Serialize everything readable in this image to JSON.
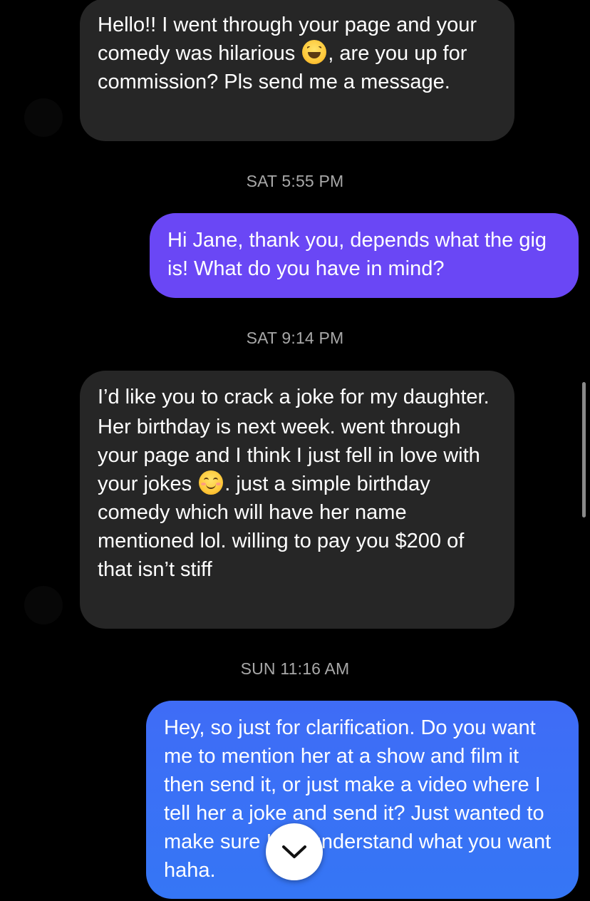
{
  "messages": [
    {
      "direction": "incoming",
      "text_a": "Hello!! I went through your page and your comedy was hilarious ",
      "emoji": "grinning-squinting-face",
      "text_b": ", are you up for commission? Pls send me a message."
    },
    {
      "direction": "timestamp",
      "text": "SAT 5:55 PM"
    },
    {
      "direction": "outgoing",
      "text": "Hi Jane, thank you, depends what the gig is! What do you have in mind?"
    },
    {
      "direction": "timestamp",
      "text": "SAT 9:14 PM"
    },
    {
      "direction": "incoming",
      "line1": "I’d like you to crack a joke for my daughter.",
      "text_a": "Her birthday is next week. went through your page and I think I just fell in love with your jokes ",
      "emoji": "smiling-face-with-smiling-eyes",
      "text_b": ". just a simple birthday comedy which will have her name mentioned lol. willing to pay you $200 of that isn’t stiff"
    },
    {
      "direction": "timestamp",
      "text": "SUN 11:16 AM"
    },
    {
      "direction": "outgoing",
      "text": "Hey, so just for clarification. Do you want me to mention her at a show and film it then send it, or just make a video where I tell her a joke and send it? Just wanted to make sure I full understand what you want haha."
    }
  ],
  "colors": {
    "background": "#000000",
    "incoming_bubble": "#262626",
    "outgoing_bubble_purple": "#6a47f5",
    "outgoing_bubble_blue": "#3a70f5",
    "timestamp": "#a8a8a8"
  },
  "controls": {
    "scroll_down_icon": "chevron-down-icon"
  }
}
